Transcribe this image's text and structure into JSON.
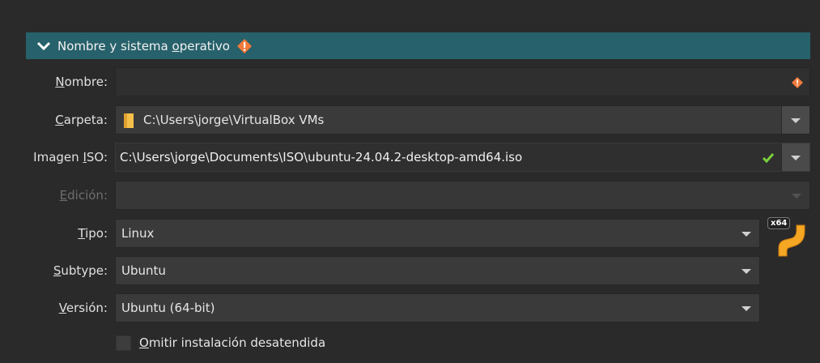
{
  "section": {
    "title_prefix": "Nombre y sistema ",
    "title_underlined": "o",
    "title_suffix": "perativo"
  },
  "fields": {
    "nombre": {
      "label_u": "N",
      "label_rest": "ombre:",
      "value": ""
    },
    "carpeta": {
      "label_u": "C",
      "label_rest": "arpeta:",
      "value": "C:\\Users\\jorge\\VirtualBox VMs"
    },
    "iso": {
      "label_pre": "Imagen ",
      "label_u": "I",
      "label_rest": "SO:",
      "value": "C:\\Users\\jorge\\Documents\\ISO\\ubuntu-24.04.2-desktop-amd64.iso"
    },
    "edicion": {
      "label_u": "E",
      "label_rest": "dición:",
      "value": ""
    },
    "tipo": {
      "label_u": "T",
      "label_rest": "ipo:",
      "value": "Linux"
    },
    "subtype": {
      "label_u": "S",
      "label_rest": "ubtype:",
      "value": "Ubuntu"
    },
    "version": {
      "label_u": "V",
      "label_rest": "ersión:",
      "value": "Ubuntu (64-bit)"
    }
  },
  "unattended": {
    "label_u": "O",
    "label_rest": "mitir instalación desatendida",
    "checked": false
  },
  "os_icon": {
    "badge": "x64"
  },
  "colors": {
    "header": "#27616b",
    "warning": "#f07a3a",
    "ok": "#7bd13a"
  }
}
